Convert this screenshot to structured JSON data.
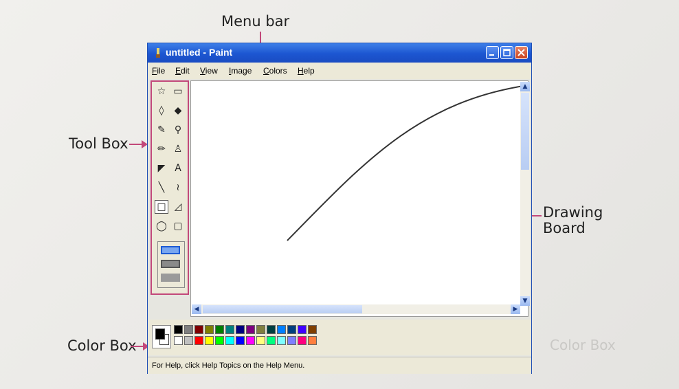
{
  "labels": {
    "menu_bar": "Menu bar",
    "tool_box": "Tool Box",
    "drawing_board_line1": "Drawing",
    "drawing_board_line2": "Board",
    "color_box": "Color Box"
  },
  "window": {
    "title": "untitled - Paint"
  },
  "menu": {
    "items": [
      {
        "label": "File",
        "mnemonic": "F"
      },
      {
        "label": "Edit",
        "mnemonic": "E"
      },
      {
        "label": "View",
        "mnemonic": "V"
      },
      {
        "label": "Image",
        "mnemonic": "I"
      },
      {
        "label": "Colors",
        "mnemonic": "C"
      },
      {
        "label": "Help",
        "mnemonic": "H"
      }
    ]
  },
  "tools": [
    {
      "name": "free-form-select-icon",
      "glyph": "☆"
    },
    {
      "name": "select-icon",
      "glyph": "▭"
    },
    {
      "name": "eraser-icon",
      "glyph": "◊"
    },
    {
      "name": "fill-icon",
      "glyph": "◆"
    },
    {
      "name": "pick-color-icon",
      "glyph": "✎"
    },
    {
      "name": "magnifier-icon",
      "glyph": "⚲"
    },
    {
      "name": "pencil-icon",
      "glyph": "✏"
    },
    {
      "name": "brush-icon",
      "glyph": "♙"
    },
    {
      "name": "airbrush-icon",
      "glyph": "◤"
    },
    {
      "name": "text-icon",
      "glyph": "A"
    },
    {
      "name": "line-icon",
      "glyph": "╲"
    },
    {
      "name": "curve-icon",
      "glyph": "≀"
    },
    {
      "name": "rectangle-icon",
      "glyph": "□"
    },
    {
      "name": "polygon-icon",
      "glyph": "◿"
    },
    {
      "name": "ellipse-icon",
      "glyph": "◯"
    },
    {
      "name": "rounded-rectangle-icon",
      "glyph": "▢"
    }
  ],
  "palette": {
    "top": [
      "#000000",
      "#7f7f7f",
      "#7f0000",
      "#7f7f00",
      "#007f00",
      "#007f7f",
      "#00007f",
      "#7f007f",
      "#7f7f3f",
      "#003f3f",
      "#007fff",
      "#003f7f",
      "#3f00ff",
      "#7f3f00"
    ],
    "bottom": [
      "#ffffff",
      "#c0c0c0",
      "#ff0000",
      "#ffff00",
      "#00ff00",
      "#00ffff",
      "#0000ff",
      "#ff00ff",
      "#ffff7f",
      "#00ff7f",
      "#7fffff",
      "#7f7fff",
      "#ff007f",
      "#ff7f3f"
    ]
  },
  "colors": {
    "callout": "#c2487a",
    "titlebar": "#1c56d1"
  },
  "status": {
    "text": "For Help, click Help Topics on the Help Menu."
  }
}
